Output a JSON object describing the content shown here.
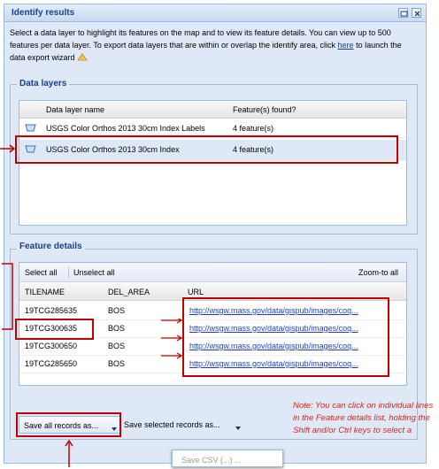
{
  "window": {
    "title": "Identify results"
  },
  "intro": {
    "text_before_link": "Select a data layer to highlight its features on the map and to view its feature details. You can view up to 500 features per data layer. To export data layers that are within or overlap the identify area, click ",
    "link": "here",
    "text_after_link": " to launch the data export wizard"
  },
  "data_layers": {
    "legend": "Data layers",
    "columns": [
      "Data layer name",
      "Feature(s) found?"
    ],
    "rows": [
      {
        "name": "USGS Color Orthos 2013 30cm Index Labels",
        "found": "4 feature(s)"
      },
      {
        "name": "USGS Color Orthos 2013 30cm Index",
        "found": "4 feature(s)"
      }
    ]
  },
  "feature_details": {
    "legend": "Feature details",
    "toolbar": {
      "select_all": "Select all",
      "unselect_all": "Unselect all",
      "zoom_to_all": "Zoom-to all"
    },
    "columns": [
      "TILENAME",
      "DEL_AREA",
      "URL"
    ],
    "rows": [
      {
        "tilename": "19TCG285635",
        "del_area": "BOS",
        "url": "http://wsgw.mass.gov/data/gispub/images/coq..."
      },
      {
        "tilename": "19TCG300635",
        "del_area": "BOS",
        "url": "http://wsgw.mass.gov/data/gispub/images/coq..."
      },
      {
        "tilename": "19TCG300650",
        "del_area": "BOS",
        "url": "http://wsgw.mass.gov/data/gispub/images/coq..."
      },
      {
        "tilename": "19TCG285650",
        "del_area": "BOS",
        "url": "http://wsgw.mass.gov/data/gispub/images/coq..."
      }
    ]
  },
  "buttons": {
    "save_all": "Save all records as...",
    "save_selected": "Save selected records as..."
  },
  "popup": {
    "text": "Save CSV (...) ..."
  },
  "note": "Note: You can click on individual lines in the Feature details list, holding the Shift and/or Ctrl keys to select a",
  "colors": {
    "annotation_red": "#c00000",
    "header_blue": "#15428b",
    "selected_row": "#dfe8f6"
  }
}
